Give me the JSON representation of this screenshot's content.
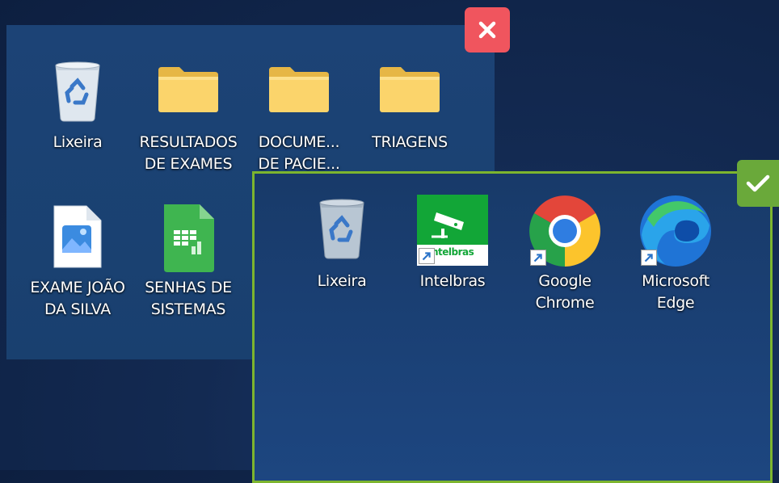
{
  "bad_panel": {
    "status": "incorrect",
    "badge_color": "#f0555e",
    "icons": [
      {
        "name": "Lixeira",
        "line1": "Lixeira",
        "line2": ""
      },
      {
        "name": "RESULTADOS DE EXAMES",
        "line1": "RESULTADOS",
        "line2": "DE EXAMES"
      },
      {
        "name": "DOCUMENTOS DE PACIENTES",
        "line1": "DOCUME...",
        "line2": "DE PACIE..."
      },
      {
        "name": "TRIAGENS",
        "line1": "TRIAGENS",
        "line2": ""
      },
      {
        "name": "EXAME JOÃO DA SILVA",
        "line1": "EXAME JOÃO",
        "line2": "DA SILVA"
      },
      {
        "name": "SENHAS DE SISTEMAS",
        "line1": "SENHAS DE",
        "line2": "SISTEMAS"
      }
    ]
  },
  "good_panel": {
    "status": "correct",
    "badge_color": "#6aa93a",
    "icons": [
      {
        "name": "Lixeira",
        "line1": "Lixeira",
        "line2": ""
      },
      {
        "name": "Intelbras",
        "line1": "Intelbras",
        "line2": "",
        "logo_text": "ntelbras"
      },
      {
        "name": "Google Chrome",
        "line1": "Google",
        "line2": "Chrome"
      },
      {
        "name": "Microsoft Edge",
        "line1": "Microsoft",
        "line2": "Edge"
      }
    ]
  },
  "icons": {
    "recycle_bin": "recycle-bin-icon",
    "folder": "folder-icon",
    "image_file": "image-file-icon",
    "spreadsheet": "spreadsheet-icon",
    "close": "close-icon",
    "check": "check-icon"
  }
}
